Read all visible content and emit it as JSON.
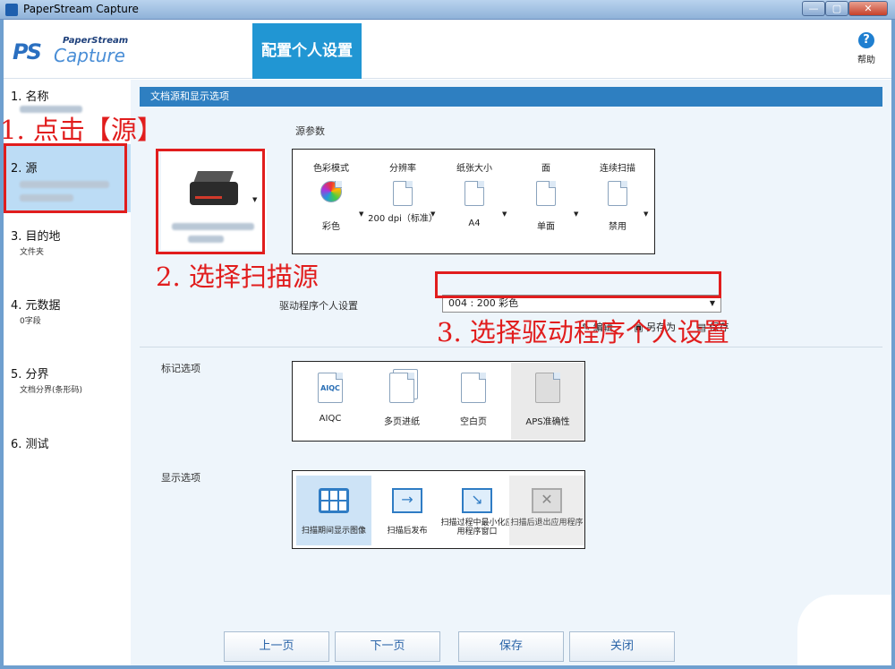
{
  "window": {
    "title": "PaperStream Capture"
  },
  "titlebar_buttons": {
    "minimize": "—",
    "maximize": "▢",
    "close": "✕"
  },
  "logo": {
    "mark": "PS",
    "top": "PaperStream",
    "bottom": "Capture"
  },
  "header": {
    "page_title": "配置个人设置",
    "help_label": "帮助",
    "help_glyph": "?"
  },
  "sidebar": {
    "steps": [
      {
        "label": "1. 名称",
        "sub": ""
      },
      {
        "label": "2. 源",
        "sub": ""
      },
      {
        "label": "3. 目的地",
        "sub": "文件夹"
      },
      {
        "label": "4. 元数据",
        "sub": "0字段"
      },
      {
        "label": "5. 分界",
        "sub": "文档分界(条形码)"
      },
      {
        "label": "6. 测试",
        "sub": ""
      }
    ]
  },
  "section": {
    "title": "文档源和显示选项",
    "source_params_label": "源参数"
  },
  "source_params": [
    {
      "label": "色彩模式",
      "value": "彩色",
      "icon": "color-wheel-icon"
    },
    {
      "label": "分辨率",
      "value": "200 dpi（标准）",
      "icon": "resolution-icon"
    },
    {
      "label": "纸张大小",
      "value": "A4",
      "icon": "paper-size-icon"
    },
    {
      "label": "面",
      "value": "单面",
      "icon": "single-side-icon"
    },
    {
      "label": "连续扫描",
      "value": "禁用",
      "icon": "continuous-scan-icon"
    }
  ],
  "driver_profile": {
    "label": "驱动程序个人设置",
    "value": "004 : 200 彩色"
  },
  "profile_actions": {
    "edit": "编辑",
    "save_as": "另存为",
    "save": "保存"
  },
  "marking_options": {
    "label": "标记选项",
    "items": [
      {
        "label": "AIQC",
        "icon_text": "AIQC"
      },
      {
        "label": "多页进纸"
      },
      {
        "label": "空白页"
      },
      {
        "label": "APS准确性"
      }
    ]
  },
  "display_options": {
    "label": "显示选项",
    "items": [
      {
        "label": "扫描期间显示图像"
      },
      {
        "label": "扫描后发布"
      },
      {
        "label": "扫描过程中最小化应用程序窗口"
      },
      {
        "label": "扫描后退出应用程序"
      }
    ]
  },
  "annotations": {
    "step1": "1. 点击【源】",
    "step2": "2. 选择扫描源",
    "step3": "3. 选择驱动程序个人设置"
  },
  "footer": {
    "prev": "上一页",
    "next": "下一页",
    "save": "保存",
    "close": "关闭"
  },
  "colors": {
    "accent": "#2196d3",
    "annotation": "#e11d1d",
    "section_bar": "#2e7fc1"
  }
}
